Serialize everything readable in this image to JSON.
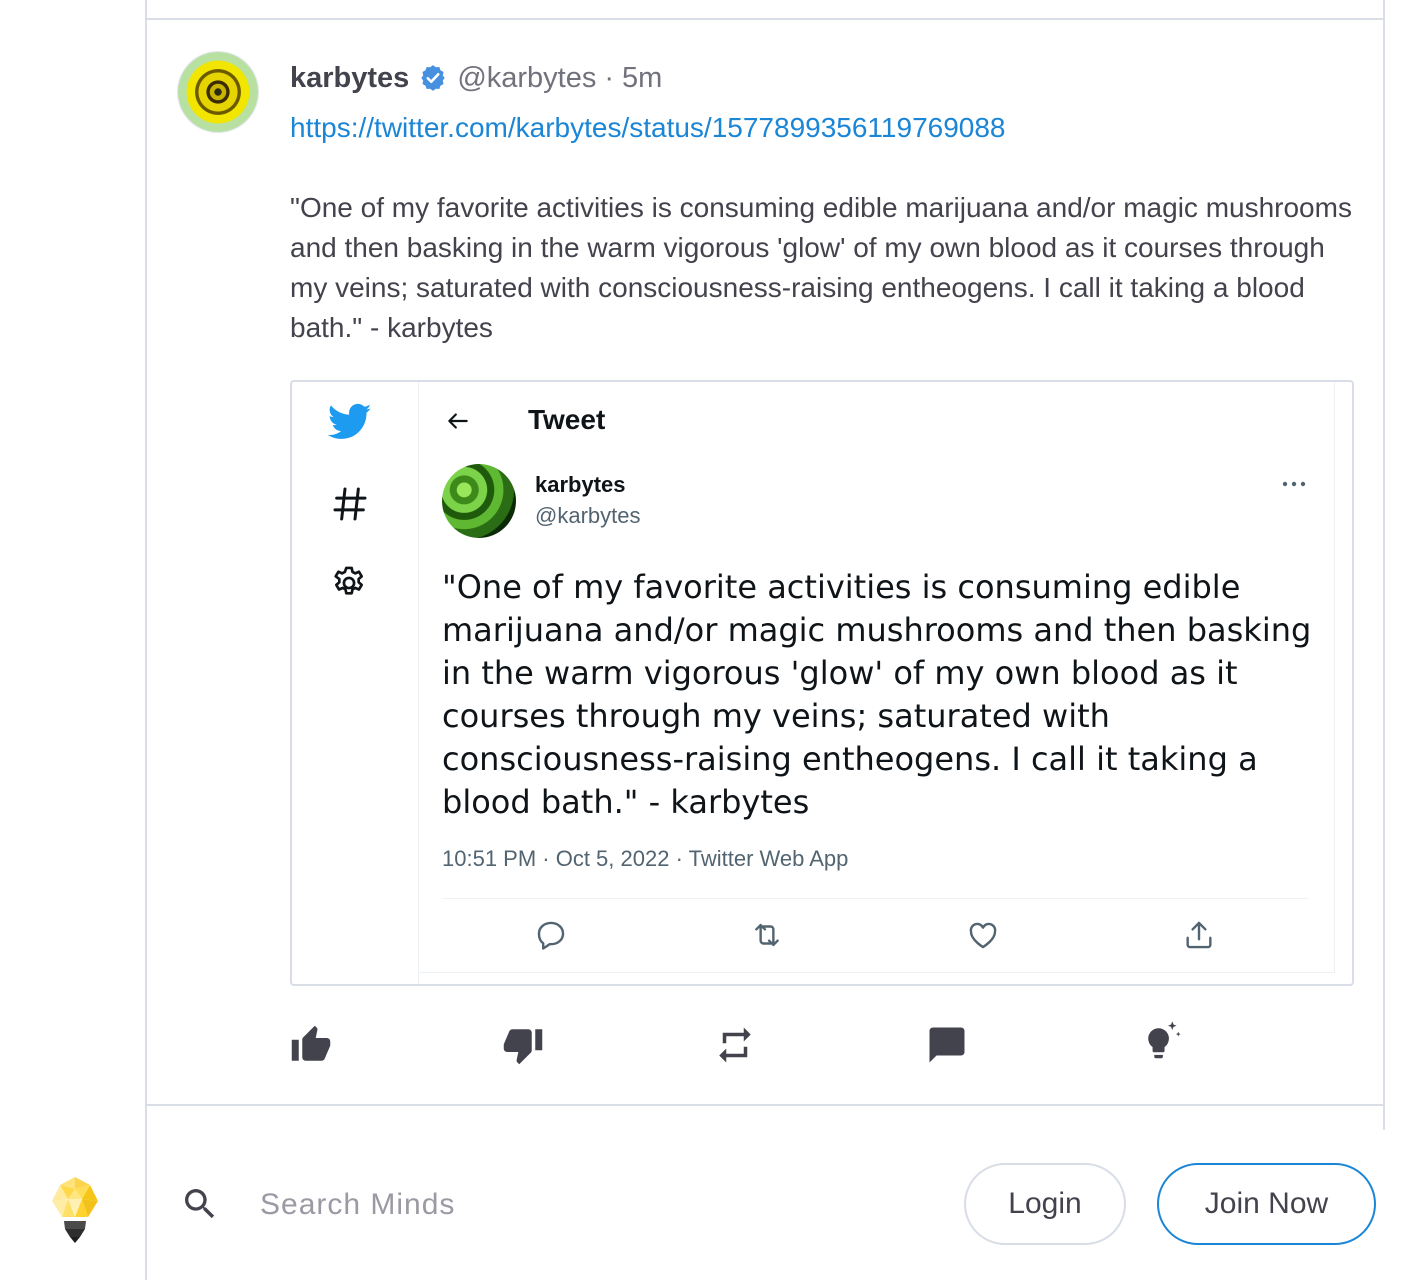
{
  "post": {
    "author_name": "karbytes",
    "handle": "@karbytes",
    "separator": "·",
    "time_ago": "5m",
    "link": "https://twitter.com/karbytes/status/1577899356119769088",
    "text": "\"One of my favorite activities is consuming edible marijuana and/or magic mushrooms and then basking in the warm vigorous 'glow' of my own blood as it courses through my veins; saturated with consciousness-raising entheogens. I call it taking a blood bath.\" - karbytes"
  },
  "embed": {
    "header_title": "Tweet",
    "author_name": "karbytes",
    "handle": "@karbytes",
    "text": "\"One of my favorite activities is consuming edible marijuana and/or magic mushrooms and then basking in the warm vigorous 'glow' of my own blood as it courses through my veins; saturated with consciousness-raising entheogens. I call it taking a blood bath.\" - karbytes",
    "meta": "10:51 PM · Oct 5, 2022 · Twitter Web App",
    "icons": [
      "twitter-bird-icon",
      "hashtag-icon",
      "settings-gear-icon",
      "back-arrow-icon",
      "more-options-icon",
      "reply-icon",
      "retweet-icon",
      "like-icon",
      "share-icon"
    ]
  },
  "actions": {
    "icons": [
      "thumbs-up-icon",
      "thumbs-down-icon",
      "remind-icon",
      "comment-icon",
      "boost-icon"
    ]
  },
  "footer": {
    "search_placeholder": "Search Minds",
    "login_label": "Login",
    "join_label": "Join Now"
  },
  "colors": {
    "accent": "#1b85d6",
    "text": "#43434d",
    "muted": "#72727c",
    "border": "#d8dde6",
    "twitter_blue": "#1d9bf0",
    "verified": "#4690df"
  }
}
